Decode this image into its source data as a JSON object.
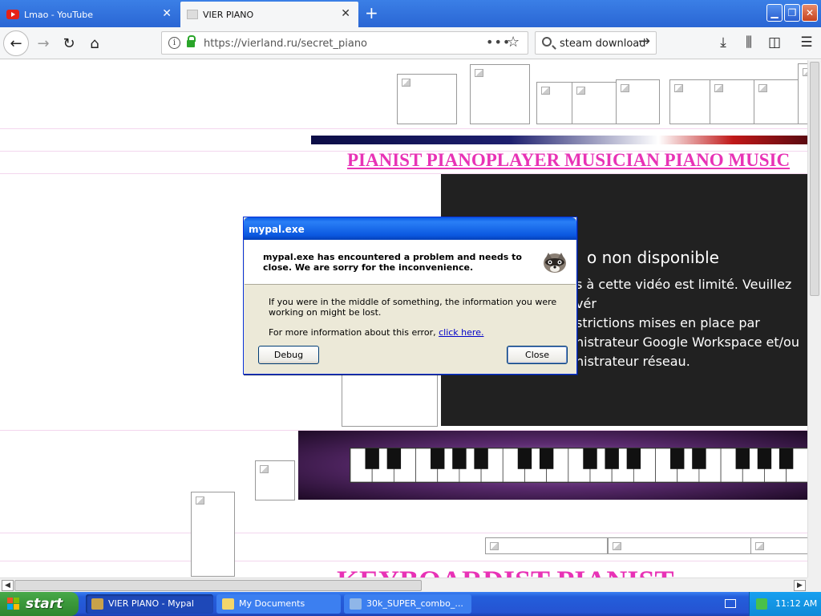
{
  "browser": {
    "tabs": [
      {
        "label": "Lmao - YouTube",
        "close": "✕"
      },
      {
        "label": "VIER PIANO",
        "close": "✕"
      }
    ],
    "new_tab": "+",
    "window_buttons": {
      "minimize": "▁",
      "maximize": "❐",
      "close": "✕"
    },
    "nav": {
      "back": "←",
      "forward": "→",
      "reload": "↻",
      "home": "⌂"
    },
    "url": "https://vierland.ru/secret_piano",
    "page_actions": "•••",
    "bookmark": "☆",
    "search_value": "steam download",
    "search_go": "→",
    "toolbar": {
      "download": "⤓",
      "library": "⫼",
      "sidebar": "◫",
      "menu": "☰"
    }
  },
  "page": {
    "heading": "PIANIST PIANOPLAYER MUSICIAN PIANO MUSIC",
    "video": {
      "title": "o non disponible",
      "message": "s à cette vidéo est limité. Veuillez vér\nstrictions mises en place par\nnistrateur Google Workspace et/ou\nnistrateur réseau."
    },
    "bottom_heading": "KEYBOARDIST  PIANIST"
  },
  "dialog": {
    "title": "mypal.exe",
    "message": "mypal.exe has encountered a problem and needs to close.  We are sorry for the inconvenience.",
    "info1": "If you were in the middle of something, the information you were working on might be lost.",
    "info2_prefix": "For more information about this error, ",
    "info2_link": "click here.",
    "debug_label": "Debug",
    "close_label": "Close"
  },
  "scrollbars": {
    "left_arrow": "◀",
    "right_arrow": "▶"
  },
  "taskbar": {
    "start_label": "start",
    "items": [
      {
        "label": "VIER PIANO - Mypal"
      },
      {
        "label": "My Documents"
      },
      {
        "label": "30k_SUPER_combo_..."
      }
    ],
    "clock": "11:12 AM"
  },
  "colors": {
    "accent_pink": "#e833b6",
    "titlebar_blue": "#0a5be5",
    "taskbar_blue": "#245edb",
    "start_green": "#3c9a3c",
    "video_bg": "#212121"
  }
}
